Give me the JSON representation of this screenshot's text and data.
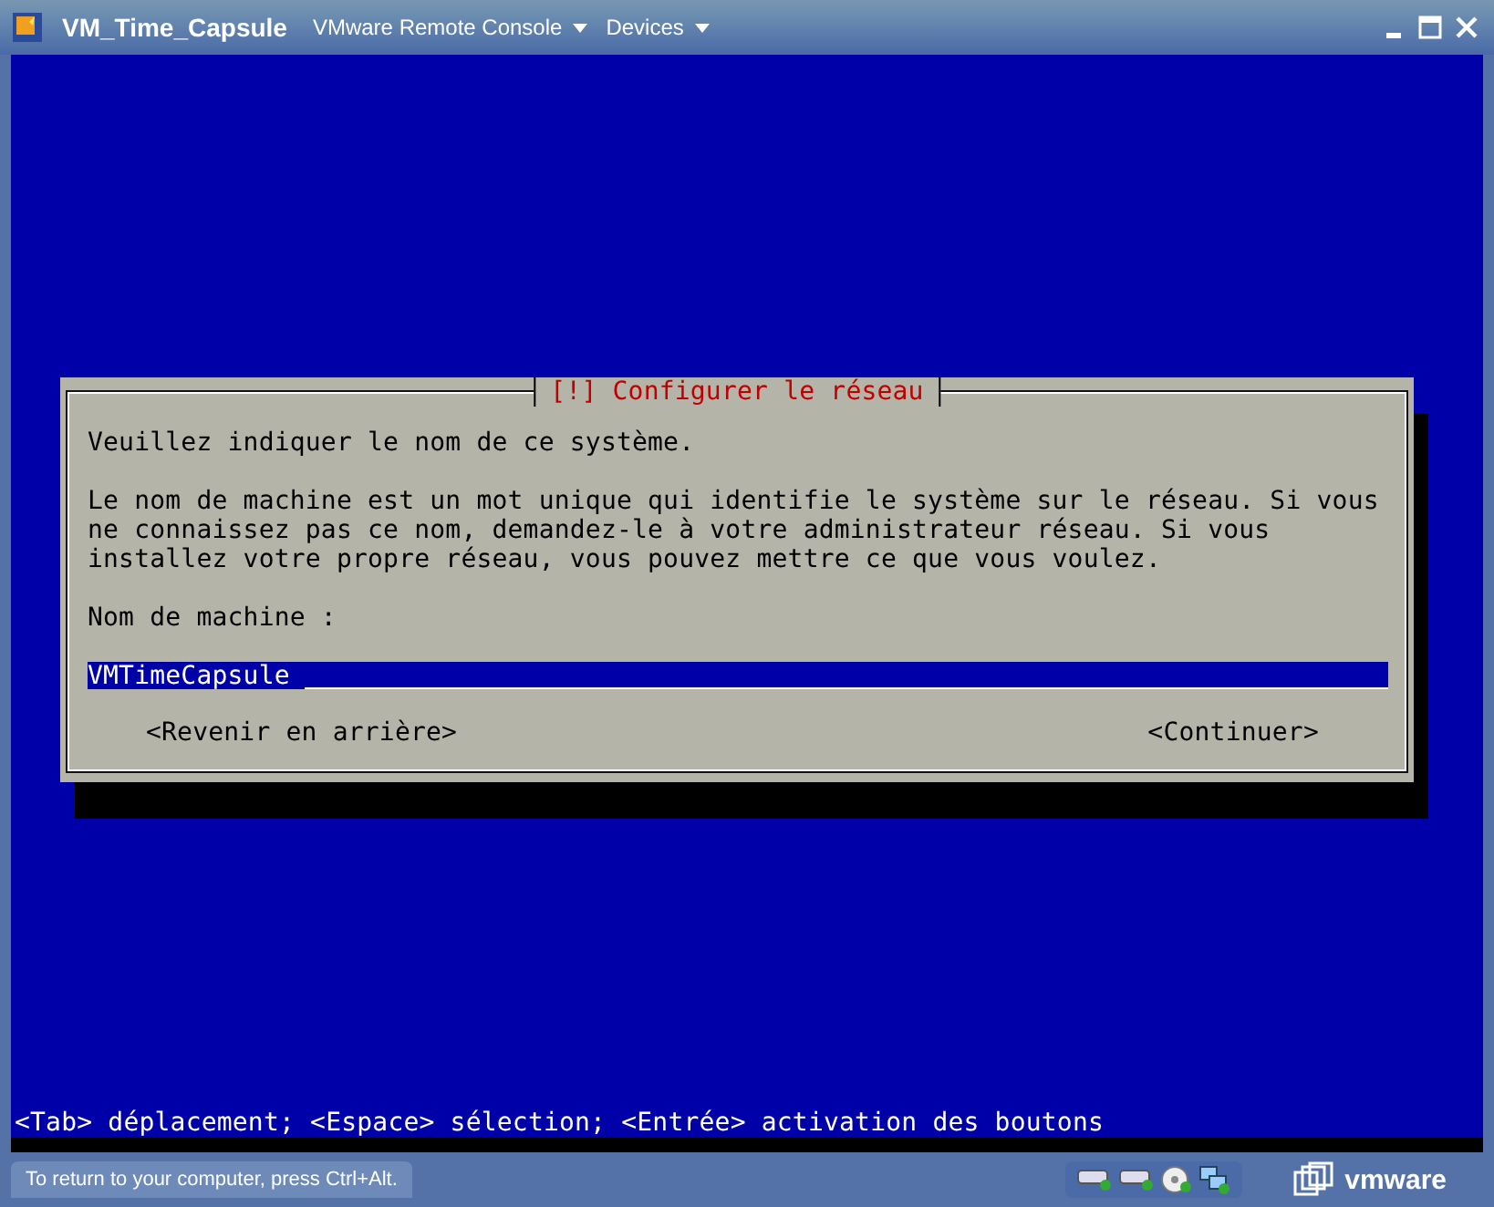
{
  "window": {
    "title": "VM_Time_Capsule",
    "menus": [
      "VMware Remote Console",
      "Devices"
    ]
  },
  "dialog": {
    "title": "[!] Configurer le réseau",
    "paragraphs": [
      "Veuillez indiquer le nom de ce système.",
      "Le nom de machine est un mot unique qui identifie le système sur le réseau. Si vous ne connaissez pas ce nom, demandez-le à votre administrateur réseau. Si vous installez votre propre réseau, vous pouvez mettre ce que vous voulez."
    ],
    "field_label": "Nom de machine :",
    "field": {
      "value": "VMTimeCapsule"
    },
    "buttons": [
      "<Revenir en arrière>",
      "<Continuer>"
    ]
  },
  "help_line": "<Tab> déplacement; <Espace> sélection; <Entrée> activation des boutons",
  "status_bar": {
    "message": "To return to your computer, press Ctrl+Alt.",
    "logo": "vmware"
  }
}
